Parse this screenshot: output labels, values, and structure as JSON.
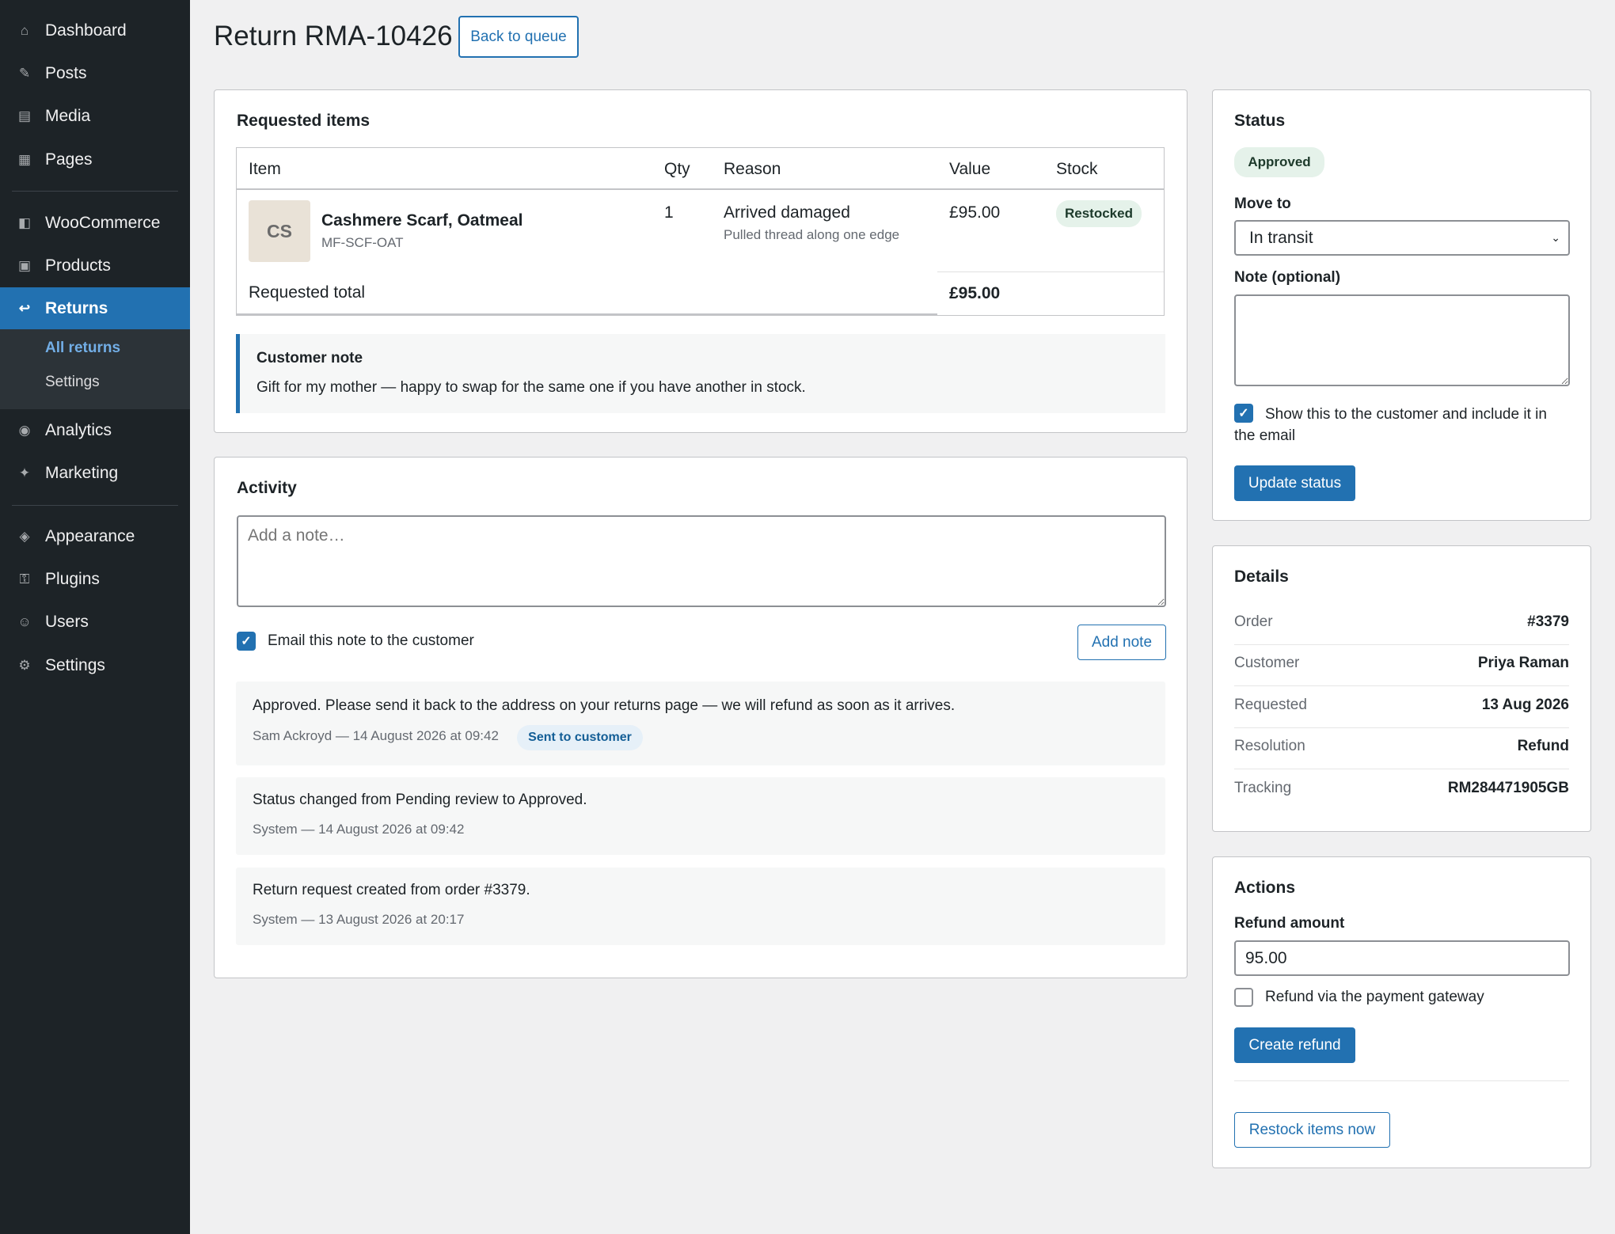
{
  "sidebar": {
    "items": [
      {
        "label": "Dashboard",
        "icon": "home-icon"
      },
      {
        "label": "Posts",
        "icon": "pencil-icon"
      },
      {
        "label": "Media",
        "icon": "media-icon"
      },
      {
        "label": "Pages",
        "icon": "pages-icon"
      },
      {
        "label": "WooCommerce",
        "icon": "woocommerce-icon"
      },
      {
        "label": "Products",
        "icon": "box-icon"
      },
      {
        "label": "Returns",
        "icon": "return-arrow-icon"
      },
      {
        "label": "Analytics",
        "icon": "chart-icon"
      },
      {
        "label": "Marketing",
        "icon": "megaphone-icon"
      },
      {
        "label": "Appearance",
        "icon": "paint-icon"
      },
      {
        "label": "Plugins",
        "icon": "plug-icon"
      },
      {
        "label": "Users",
        "icon": "user-icon"
      },
      {
        "label": "Settings",
        "icon": "gear-icon"
      }
    ],
    "submenu": [
      {
        "label": "All returns"
      },
      {
        "label": "Settings"
      }
    ]
  },
  "header": {
    "title": "Return RMA-10426",
    "back_label": "Back to queue"
  },
  "requested": {
    "title": "Requested items",
    "columns": [
      "Item",
      "Qty",
      "Reason",
      "Value",
      "Stock"
    ],
    "item": {
      "thumb": "CS",
      "name": "Cashmere Scarf, Oatmeal",
      "sku": "MF-SCF-OAT",
      "qty": "1",
      "reason": "Arrived damaged",
      "reason_detail": "Pulled thread along one edge",
      "value": "£95.00",
      "stock": "Restocked"
    },
    "total_label": "Requested total",
    "total_value": "£95.00",
    "note_title": "Customer note",
    "note_text": "Gift for my mother — happy to swap for the same one if you have another in stock."
  },
  "activity": {
    "title": "Activity",
    "placeholder": "Add a note…",
    "email_label": "Email this note to the customer",
    "add_label": "Add note",
    "entries": [
      {
        "text": "Approved. Please send it back to the address on your returns page — we will refund as soon as it arrives.",
        "meta": "Sam Ackroyd — 14 August 2026 at 09:42",
        "badge": "Sent to customer"
      },
      {
        "text": "Status changed from Pending review to Approved.",
        "meta": "System — 14 August 2026 at 09:42"
      },
      {
        "text": "Return request created from order #3379.",
        "meta": "System — 13 August 2026 at 20:17"
      }
    ]
  },
  "status": {
    "title": "Status",
    "badge": "Approved",
    "move_label": "Move to",
    "move_value": "In transit",
    "note_label": "Note (optional)",
    "show_label": "Show this to the customer and include it in the email",
    "update_label": "Update status"
  },
  "details": {
    "title": "Details",
    "rows": [
      {
        "label": "Order",
        "value": "#3379"
      },
      {
        "label": "Customer",
        "value": "Priya Raman"
      },
      {
        "label": "Requested",
        "value": "13 Aug 2026"
      },
      {
        "label": "Resolution",
        "value": "Refund"
      },
      {
        "label": "Tracking",
        "value": "RM284471905GB"
      }
    ]
  },
  "actions": {
    "title": "Actions",
    "refund_label": "Refund amount",
    "refund_value": "95.00",
    "gateway_label": "Refund via the payment gateway",
    "create_label": "Create refund",
    "restock_label": "Restock items now"
  }
}
